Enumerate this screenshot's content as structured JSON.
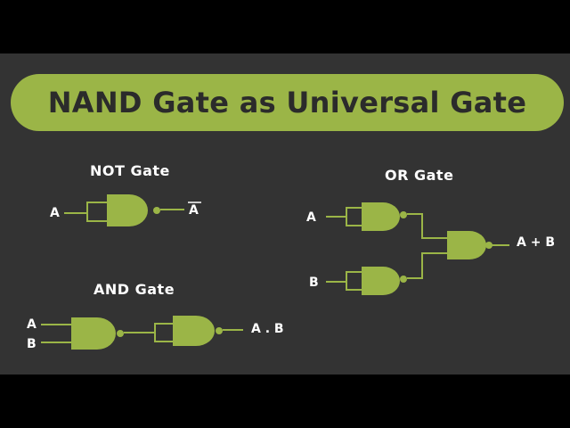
{
  "title": "NAND Gate as Universal Gate",
  "colors": {
    "background": "#333333",
    "letterbox": "#000000",
    "accent": "#9bb547",
    "wire": "#9bb547",
    "text": "#ffffff",
    "title_text": "#2b2b2b"
  },
  "sections": {
    "not": {
      "title": "NOT Gate",
      "input": "A",
      "output": "A"
    },
    "and": {
      "title": "AND Gate",
      "input_a": "A",
      "input_b": "B",
      "output": "A . B"
    },
    "or": {
      "title": "OR Gate",
      "input_a": "A",
      "input_b": "B",
      "output": "A + B"
    }
  },
  "gates": [
    "nand",
    "nand",
    "nand",
    "nand",
    "nand",
    "nand"
  ]
}
